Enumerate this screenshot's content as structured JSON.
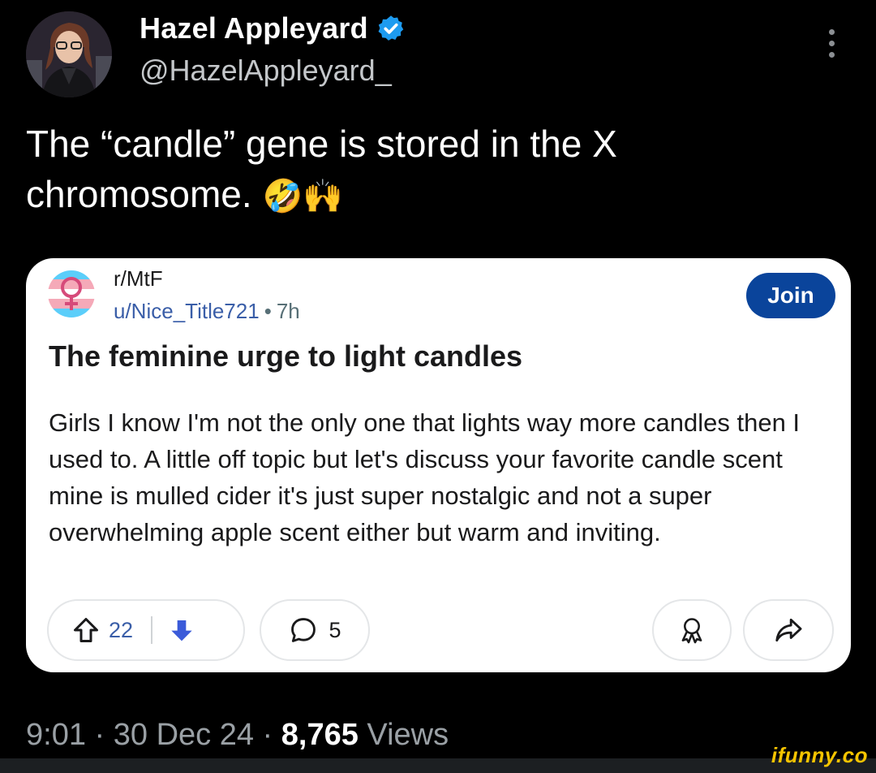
{
  "tweet": {
    "display_name": "Hazel Appleyard",
    "handle": "@HazelAppleyard_",
    "text": "The “candle” gene is stored in the X chromosome.",
    "emojis": "🤣🙌",
    "verified_icon": "verified-badge-icon",
    "time": "9:01",
    "date": "30 Dec 24",
    "views_count": "8,765",
    "views_label": "Views",
    "separator": "·"
  },
  "embedded_post": {
    "subreddit": "r/MtF",
    "author": "u/Nice_Title721",
    "dot": "•",
    "age": "7h",
    "join_label": "Join",
    "title": "The feminine urge to light candles",
    "body": "Girls I know I'm not the only one that lights way more candles then I used to. A little off topic but let's discuss your favorite candle scent mine is mulled cider it's just super nostalgic and not a super overwhelming apple scent either but warm and inviting.",
    "score": "22",
    "comments_count": "5"
  },
  "colors": {
    "background": "#000000",
    "verified_blue": "#1d9bf0",
    "join_blue": "#0a449b",
    "downvote_blue": "#3b5bd9",
    "trans_blue": "#5bcefa",
    "trans_pink": "#f5a9b8",
    "watermark_yellow": "#f5c400"
  },
  "watermark": "ifunny.co"
}
